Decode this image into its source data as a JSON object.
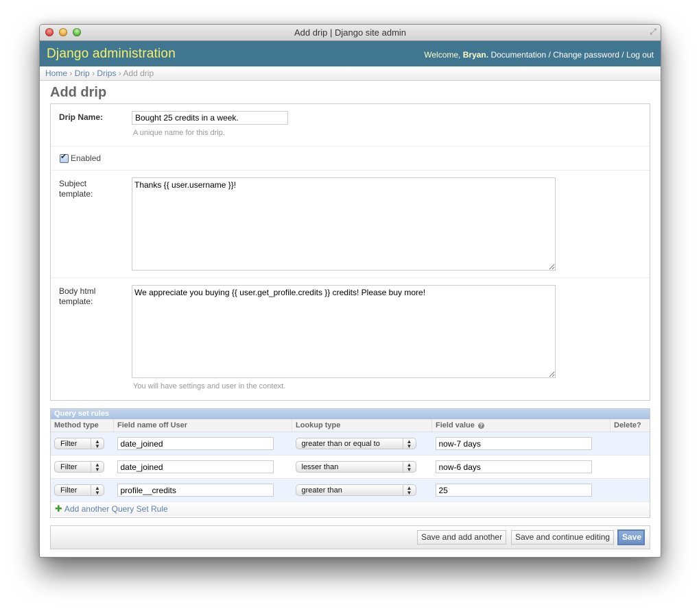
{
  "window": {
    "title": "Add drip | Django site admin",
    "controls": [
      "close",
      "minimize",
      "zoom"
    ],
    "fullscreen_icon": "fullscreen-arrows-icon"
  },
  "header": {
    "branding": "Django administration",
    "welcome_prefix": "Welcome, ",
    "username": "Bryan.",
    "links": [
      "Documentation",
      "Change password",
      "Log out"
    ],
    "separator": "/"
  },
  "breadcrumbs": {
    "items": [
      "Home",
      "Drip",
      "Drips"
    ],
    "current": "Add drip",
    "separator": "›"
  },
  "page": {
    "title": "Add drip"
  },
  "form": {
    "name": {
      "label": "Drip Name:",
      "value": "Bought 25 credits in a week.",
      "help": "A unique name for this drip."
    },
    "enabled": {
      "label": "Enabled",
      "checked": true
    },
    "subject_template": {
      "label_line1": "Subject",
      "label_line2": "template:",
      "value": "Thanks {{ user.username }}!"
    },
    "body_html_template": {
      "label_line1": "Body html",
      "label_line2": "template:",
      "value": "We appreciate you buying {{ user.get_profile.credits }} credits! Please buy more!",
      "help": "You will have settings and user in the context."
    }
  },
  "inline": {
    "title": "Query set rules",
    "columns": [
      "Method type",
      "Field name off User",
      "Lookup type",
      "Field value",
      "Delete?"
    ],
    "rows": [
      {
        "method": "Filter",
        "field_name": "date_joined",
        "lookup": "greater than or equal to",
        "value": "now-7 days"
      },
      {
        "method": "Filter",
        "field_name": "date_joined",
        "lookup": "lesser than",
        "value": "now-6 days"
      },
      {
        "method": "Filter",
        "field_name": "profile__credits",
        "lookup": "greater than",
        "value": "25"
      }
    ],
    "add_link": "Add another Query Set Rule"
  },
  "submit": {
    "save_add_another": "Save and add another",
    "save_continue": "Save and continue editing",
    "save": "Save"
  },
  "colors": {
    "header_bg": "#417690",
    "branding": "#f5f26a",
    "link": "#5b80b2",
    "inline_title_bg": "#a8c2e2",
    "row_alt": "#edf3fe",
    "save_button": "#6b90c4"
  }
}
